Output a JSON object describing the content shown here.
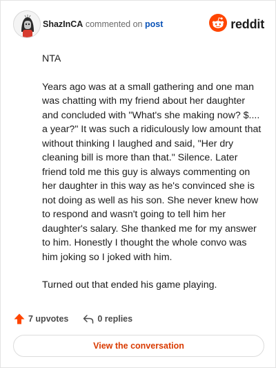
{
  "header": {
    "username": "ShazInCA",
    "verb": "commented on",
    "post_link": "post",
    "brand": "reddit",
    "brand_color": "#ff4500"
  },
  "comment": {
    "paragraphs": [
      "NTA",
      "Years ago was at a small gathering and one man was chatting with my friend about her daughter and concluded with \"What's she making now? $.... a year?\" It was such a ridiculously low amount that without thinking I laughed and said, \"Her dry cleaning bill is more than that.\" Silence. Later friend told me this guy is always commenting on her daughter in this way as he's convinced she is not doing as well as his son. She never knew how to respond and wasn't going to tell him her daughter's salary. She thanked me for my answer to him. Honestly I thought the whole convo was him joking so I joked with him.",
      "Turned out that ended his game playing."
    ]
  },
  "actions": {
    "upvotes": "7 upvotes",
    "replies": "0 replies",
    "upvote_color": "#ff4500"
  },
  "footer": {
    "view_button": "View the conversation",
    "accent": "#d93a00"
  },
  "icons": [
    "avatar",
    "reddit-logo-icon",
    "upvote-arrow-icon",
    "reply-arrow-icon"
  ]
}
